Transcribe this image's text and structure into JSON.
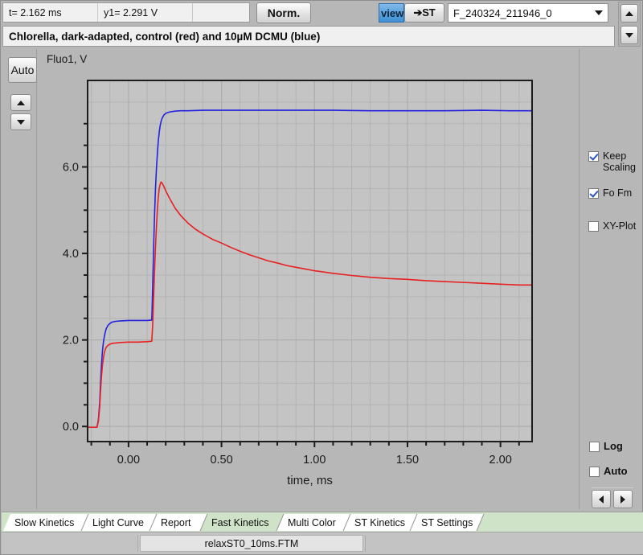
{
  "topbar": {
    "t_readout": "t= 2.162 ms",
    "y1_readout": "y1= 2.291 V",
    "extra_readout": "",
    "norm_label": "Norm.",
    "view_label": "view",
    "st_label": "➔ST",
    "file_select_value": "F_240324_211946_0",
    "dropdown_icon": "chevron-down-icon",
    "spin_up_icon": "triangle-up-icon",
    "spin_down_icon": "triangle-down-icon"
  },
  "title": {
    "text": "Chlorella, dark-adapted, control (red) and 10µM DCMU (blue)"
  },
  "left_controls": {
    "auto_label": "Auto",
    "up_icon": "triangle-up-icon",
    "down_icon": "triangle-down-icon"
  },
  "right_controls": {
    "checkboxes": [
      {
        "label": "Keep Scaling",
        "checked": true
      },
      {
        "label": "Fo Fm",
        "checked": true
      },
      {
        "label": "XY-Plot",
        "checked": false
      },
      {
        "label": "Log",
        "checked": false
      },
      {
        "label": "Auto",
        "checked": false
      }
    ],
    "prev_icon": "triangle-left-icon",
    "next_icon": "triangle-right-icon"
  },
  "tabs": [
    {
      "label": "Slow Kinetics",
      "active": false
    },
    {
      "label": "Light Curve",
      "active": false
    },
    {
      "label": "Report",
      "active": false
    },
    {
      "label": "Fast Kinetics",
      "active": true
    },
    {
      "label": "Multi Color",
      "active": false
    },
    {
      "label": "ST Kinetics",
      "active": false
    },
    {
      "label": "ST Settings",
      "active": false
    }
  ],
  "statusbar": {
    "filename": "relaxST0_10ms.FTM"
  },
  "colors": {
    "trace_control": "#e82020",
    "trace_dcmu": "#2222e0",
    "plot_bg": "#c4c4c4",
    "panel_bg": "#b7b7b7",
    "accent_blue": "#3f8fd6",
    "tab_active": "#cfe3c8"
  },
  "chart_data": {
    "type": "line",
    "title": "Chlorella, dark-adapted, control (red) and 10µM DCMU (blue)",
    "xlabel": "time, ms",
    "ylabel": "Fluo1, V",
    "xlim": [
      -0.22,
      2.17
    ],
    "ylim": [
      -0.35,
      8.0
    ],
    "xticks": [
      0.0,
      0.5,
      1.0,
      1.5,
      2.0
    ],
    "xticklabels": [
      "0.00",
      "0.50",
      "1.00",
      "1.50",
      "2.00"
    ],
    "yticks": [
      0.0,
      2.0,
      4.0,
      6.0
    ],
    "yticklabels": [
      "0.0",
      "2.0",
      "4.0",
      "6.0"
    ],
    "yminorticks": [
      0.5,
      1.0,
      1.5,
      2.5,
      3.0,
      3.5,
      4.5,
      5.0,
      5.5,
      6.5,
      7.0
    ],
    "grid": true,
    "legend": "none",
    "cursor": {
      "t": 2.162,
      "y1": 2.291
    },
    "series": [
      {
        "name": "10µM DCMU (blue)",
        "color": "#2222e0",
        "x": [
          -0.22,
          -0.17,
          -0.162,
          -0.155,
          -0.15,
          -0.145,
          -0.14,
          -0.135,
          -0.13,
          -0.125,
          -0.12,
          -0.11,
          -0.1,
          -0.09,
          -0.07,
          -0.04,
          0.0,
          0.05,
          0.1,
          0.125,
          0.128,
          0.132,
          0.136,
          0.14,
          0.145,
          0.15,
          0.155,
          0.16,
          0.165,
          0.17,
          0.175,
          0.18,
          0.19,
          0.2,
          0.22,
          0.25,
          0.28,
          0.32,
          0.4,
          0.5,
          0.7,
          0.9,
          1.1,
          1.3,
          1.5,
          1.7,
          1.9,
          2.05,
          2.17
        ],
        "y": [
          -0.02,
          -0.02,
          0.15,
          0.55,
          1.05,
          1.45,
          1.75,
          1.95,
          2.08,
          2.18,
          2.26,
          2.34,
          2.38,
          2.41,
          2.43,
          2.44,
          2.45,
          2.45,
          2.45,
          2.46,
          2.9,
          3.6,
          4.3,
          4.9,
          5.5,
          5.95,
          6.3,
          6.6,
          6.8,
          6.95,
          7.05,
          7.12,
          7.2,
          7.24,
          7.27,
          7.29,
          7.3,
          7.3,
          7.31,
          7.31,
          7.31,
          7.31,
          7.31,
          7.3,
          7.3,
          7.3,
          7.31,
          7.3,
          7.3
        ]
      },
      {
        "name": "control (red)",
        "color": "#e82020",
        "x": [
          -0.22,
          -0.17,
          -0.162,
          -0.155,
          -0.15,
          -0.145,
          -0.14,
          -0.135,
          -0.13,
          -0.125,
          -0.12,
          -0.11,
          -0.1,
          -0.09,
          -0.07,
          -0.04,
          0.0,
          0.05,
          0.1,
          0.125,
          0.13,
          0.135,
          0.14,
          0.145,
          0.15,
          0.155,
          0.16,
          0.165,
          0.17,
          0.175,
          0.18,
          0.19,
          0.2,
          0.22,
          0.25,
          0.28,
          0.32,
          0.36,
          0.4,
          0.45,
          0.5,
          0.55,
          0.6,
          0.65,
          0.7,
          0.75,
          0.8,
          0.85,
          0.9,
          0.95,
          1.0,
          1.1,
          1.2,
          1.3,
          1.4,
          1.5,
          1.6,
          1.7,
          1.8,
          1.9,
          2.0,
          2.1,
          2.17
        ],
        "y": [
          -0.02,
          -0.02,
          0.12,
          0.45,
          0.85,
          1.18,
          1.42,
          1.58,
          1.7,
          1.78,
          1.83,
          1.88,
          1.9,
          1.92,
          1.93,
          1.94,
          1.95,
          1.95,
          1.96,
          1.97,
          2.35,
          3.0,
          3.6,
          4.15,
          4.6,
          5.0,
          5.3,
          5.5,
          5.6,
          5.65,
          5.63,
          5.55,
          5.45,
          5.28,
          5.05,
          4.88,
          4.7,
          4.56,
          4.45,
          4.33,
          4.24,
          4.14,
          4.05,
          3.97,
          3.9,
          3.83,
          3.78,
          3.72,
          3.68,
          3.64,
          3.6,
          3.54,
          3.49,
          3.45,
          3.42,
          3.4,
          3.37,
          3.35,
          3.33,
          3.31,
          3.29,
          3.27,
          3.27
        ]
      }
    ]
  }
}
